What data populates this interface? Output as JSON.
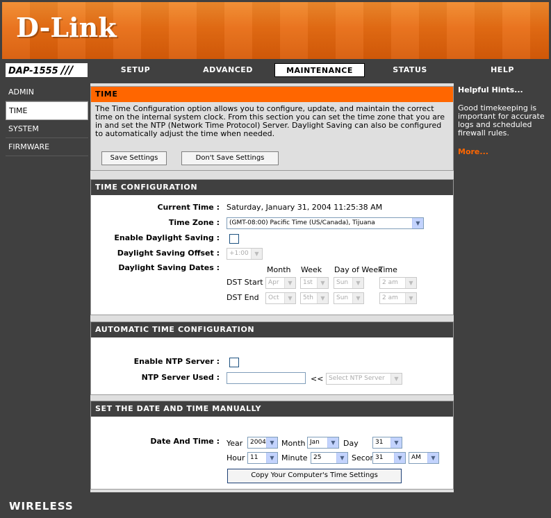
{
  "brand": {
    "logo": "D-Link",
    "model": "DAP-1555",
    "model_slashes": "///"
  },
  "nav": {
    "tabs": [
      {
        "label": "SETUP"
      },
      {
        "label": "ADVANCED"
      },
      {
        "label": "MAINTENANCE"
      },
      {
        "label": "STATUS"
      },
      {
        "label": "HELP"
      }
    ],
    "active_tab": "MAINTENANCE"
  },
  "sidebar": {
    "items": [
      {
        "label": "ADMIN"
      },
      {
        "label": "TIME"
      },
      {
        "label": "SYSTEM"
      },
      {
        "label": "FIRMWARE"
      }
    ],
    "active_item": "TIME"
  },
  "time": {
    "title": "TIME",
    "description": "The Time Configuration option allows you to configure, update, and maintain the correct time on the internal system clock. From this section you can set the time zone that you are in and set the NTP (Network Time Protocol) Server. Daylight Saving can also be configured to automatically adjust the time when needed.",
    "save_label": "Save Settings",
    "dont_save_label": "Don't Save Settings"
  },
  "time_config": {
    "title": "TIME CONFIGURATION",
    "current_time_label": "Current Time :",
    "current_time_value": "Saturday, January 31, 2004 11:25:38 AM",
    "time_zone_label": "Time Zone :",
    "time_zone_value": "(GMT-08:00) Pacific Time (US/Canada), Tijuana",
    "daylight_saving_label": "Enable Daylight Saving :",
    "daylight_saving_checked": false,
    "offset_label": "Daylight Saving Offset :",
    "offset_value": "+1:00",
    "dates_label": "Daylight Saving Dates :",
    "col_month": "Month",
    "col_week": "Week",
    "col_day": "Day of Week",
    "col_time": "Time",
    "dst_start_label": "DST Start",
    "dst_start": {
      "month": "Apr",
      "week": "1st",
      "day": "Sun",
      "time": "2 am"
    },
    "dst_end_label": "DST End",
    "dst_end": {
      "month": "Oct",
      "week": "5th",
      "day": "Sun",
      "time": "2 am"
    }
  },
  "auto_time": {
    "title": "AUTOMATIC TIME CONFIGURATION",
    "enable_ntp_label": "Enable NTP Server :",
    "enable_ntp_checked": false,
    "ntp_used_label": "NTP Server Used :",
    "ntp_used_value": "",
    "arrows": "<<",
    "ntp_select": "Select NTP Server"
  },
  "manual": {
    "title": "SET THE DATE AND TIME MANUALLY",
    "date_time_label": "Date And Time :",
    "year_label": "Year",
    "year_value": "2004",
    "month_label": "Month",
    "month_value": "Jan",
    "day_label": "Day",
    "day_value": "31",
    "hour_label": "Hour",
    "hour_value": "11",
    "minute_label": "Minute",
    "minute_value": "25",
    "second_label": "Second",
    "second_value": "31",
    "ampm_value": "AM",
    "copy_label": "Copy Your Computer's Time Settings"
  },
  "help": {
    "title": "Helpful Hints...",
    "body": "Good timekeeping is important for accurate logs and scheduled firewall rules.",
    "more": "More..."
  },
  "footer": {
    "label": "WIRELESS"
  },
  "colors": {
    "accent": "#ff6600",
    "dark": "#404040",
    "panel": "#dfdfdf"
  }
}
